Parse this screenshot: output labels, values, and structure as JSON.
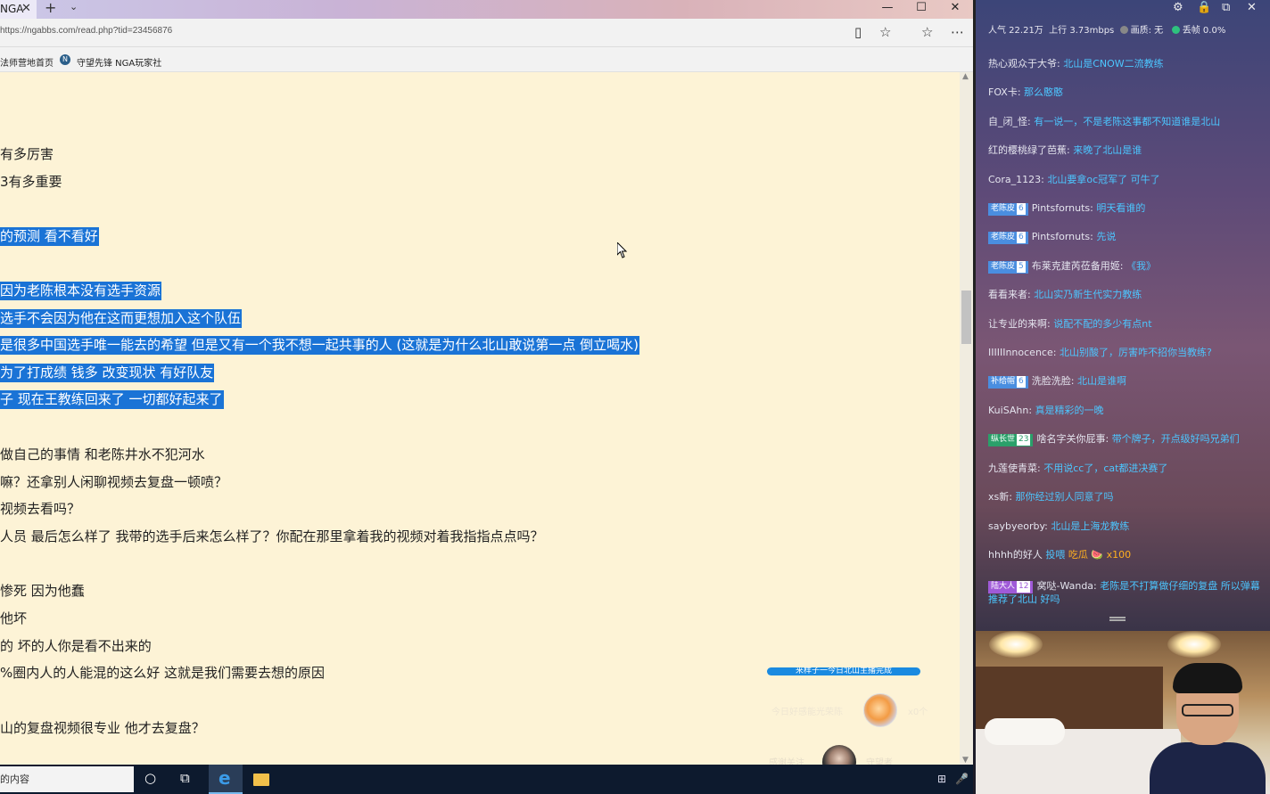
{
  "browser": {
    "tab_title": "NGA",
    "tab_close": "✕",
    "new_tab": "+",
    "tab_list": "⌄",
    "window_buttons": {
      "minimize": "—",
      "maximize": "☐",
      "close": "✕"
    },
    "url": "https://ngabbs.com/read.php?tid=23456876",
    "address_icons": {
      "reading_view": "▯",
      "favorite": "☆",
      "hub": "☆",
      "more": "⋯"
    },
    "favorites": [
      {
        "label": "法师营地首页"
      },
      {
        "label": "守望先锋 NGA玩家社",
        "icon": "N"
      }
    ]
  },
  "article": {
    "lines": [
      {
        "text": "有多厉害",
        "highlight": false
      },
      {
        "text": "3有多重要",
        "highlight": false
      },
      {
        "text": "的预测 看不看好",
        "highlight": true
      },
      {
        "text": "因为老陈根本没有选手资源",
        "highlight": true
      },
      {
        "text": "选手不会因为他在这而更想加入这个队伍",
        "highlight": true
      },
      {
        "text": "是很多中国选手唯一能去的希望 但是又有一个我不想一起共事的人 (这就是为什么北山敢说第一点 倒立喝水)",
        "highlight": true
      },
      {
        "text": "为了打成绩 钱多 改变现状 有好队友",
        "highlight": true
      },
      {
        "text": "子 现在王教练回来了 一切都好起来了",
        "highlight": true
      },
      {
        "text": "做自己的事情 和老陈井水不犯河水",
        "highlight": false
      },
      {
        "text": "嘛？还拿别人闲聊视频去复盘一顿喷？",
        "highlight": false
      },
      {
        "text": "视频去看吗？",
        "highlight": false
      },
      {
        "text": "人员 最后怎么样了 我带的选手后来怎么样了？你配在那里拿着我的视频对着我指指点点吗？",
        "highlight": false
      },
      {
        "text": "惨死 因为他蠢",
        "highlight": false
      },
      {
        "text": "他坏",
        "highlight": false
      },
      {
        "text": "的 坏的人你是看不出来的",
        "highlight": false
      },
      {
        "text": "%圈内人的人能混的这么好 这就是我们需要去想的原因",
        "highlight": false
      },
      {
        "text": "山的复盘视频很专业 他才去复盘？",
        "highlight": false
      }
    ]
  },
  "overlay": {
    "banner": "来样子一今日北山主播完成",
    "gift_label": "今日好感能光荣陈",
    "gift_count": "x0个",
    "user_left": "感谢关注",
    "user_right": "守望者"
  },
  "taskbar": {
    "search_text": "的内容",
    "cortana_icon": "○",
    "taskview_icon": "⧉",
    "edge_icon": "e",
    "tray_icons": [
      "⊞",
      "🎤"
    ]
  },
  "stream": {
    "top_icons": [
      "⚙",
      "🔒",
      "⧉",
      "✕"
    ],
    "stats": {
      "popularity": "人气 22.21万",
      "upload": "上行 3.73mbps",
      "quality": "画质: 无",
      "drop": "丢帧 0.0%",
      "quality_color": "#888888",
      "drop_color": "#2ec27e"
    },
    "messages": [
      {
        "user": "热心观众于大爷:",
        "text": "北山是CNOW二流教练"
      },
      {
        "user": "FOX卡:",
        "text": "那么憨憨"
      },
      {
        "user": "自_闭_怪:",
        "text": "有一说一，不是老陈这事都不知道谁是北山"
      },
      {
        "user": "红的樱桃绿了芭蕉:",
        "text": "来晚了北山是谁"
      },
      {
        "user": "Cora_1123:",
        "text": "北山要拿oc冠军了 可牛了"
      },
      {
        "badge": "老陈皮",
        "level": "6",
        "user": "Pintsfornuts:",
        "text": "明天看谁的"
      },
      {
        "badge": "老陈皮",
        "level": "6",
        "user": "Pintsfornuts:",
        "text": "先说"
      },
      {
        "badge": "老陈皮",
        "level": "5",
        "user": "布莱克建芮莅备用姬:",
        "text": "《我》"
      },
      {
        "user": "看看来者:",
        "text": "北山实乃新生代实力教练"
      },
      {
        "user": "让专业的来啊:",
        "text": "说配不配的多少有点nt"
      },
      {
        "user": "IIIIIInnocence:",
        "text": "北山别酸了，厉害咋不招你当教练?"
      },
      {
        "badge": "补给帽",
        "level": "6",
        "user": "洗脸洗脸:",
        "text": "北山是谁啊"
      },
      {
        "user": "KuiSAhn:",
        "text": "真是精彩的一晚"
      },
      {
        "badge": "纵长世",
        "level": "23",
        "badge_color": "green",
        "user": "啥名字关你屁事:",
        "text": "带个牌子，开点级好吗兄弟们"
      },
      {
        "user": "九莲使青菜:",
        "text": "不用说cc了，cat都进决赛了"
      },
      {
        "user": "xs新:",
        "text": "那你经过别人同意了吗"
      },
      {
        "user": "saybyeorby:",
        "text": "北山是上海龙教练"
      },
      {
        "user": "hhhh的好人",
        "text": "投喂",
        "gift": "吃瓜",
        "gift_icon": "🍉",
        "gift_count": "x100"
      },
      {
        "badge": "陆大人",
        "level": "12",
        "badge_color": "purple",
        "user": "窝哒-Wanda:",
        "text": "老陈是不打算做仔细的复盘 所以弹幕推荐了北山 好吗"
      }
    ]
  }
}
